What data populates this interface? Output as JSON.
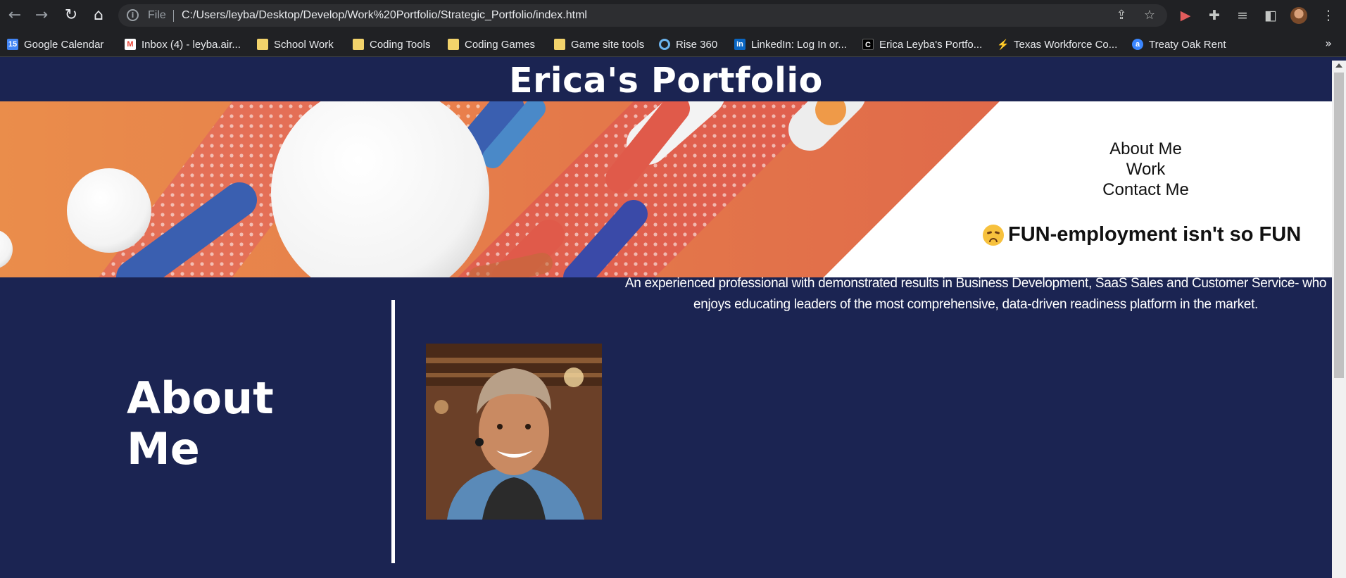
{
  "browser": {
    "url_scheme_label": "File",
    "url": "C:/Users/leyba/Desktop/Develop/Work%20Portfolio/Strategic_Portfolio/index.html",
    "bookmarks": [
      {
        "label": "Google Calendar",
        "icon": "calendar-icon",
        "color": "#4285f4"
      },
      {
        "label": "Inbox (4) - leyba.air...",
        "icon": "gmail-icon",
        "color": "#ea4335"
      },
      {
        "label": "School Work",
        "icon": "folder-icon",
        "color": "#f2d36b"
      },
      {
        "label": "Coding Tools",
        "icon": "folder-icon",
        "color": "#f2d36b"
      },
      {
        "label": "Coding Games",
        "icon": "folder-icon",
        "color": "#f2d36b"
      },
      {
        "label": "Game site tools",
        "icon": "folder-icon",
        "color": "#f2d36b"
      },
      {
        "label": "Rise 360",
        "icon": "rise-icon",
        "color": "#6cb4ee"
      },
      {
        "label": "LinkedIn: Log In or...",
        "icon": "linkedin-icon",
        "color": "#0a66c2"
      },
      {
        "label": "Erica Leyba's Portfo...",
        "icon": "codepen-icon",
        "color": "#000000"
      },
      {
        "label": "Texas Workforce Co...",
        "icon": "bolt-icon",
        "color": "#e7d44b"
      },
      {
        "label": "Treaty Oak Rent",
        "icon": "treaty-oak-icon",
        "color": "#3a86ff"
      }
    ],
    "more_label": "»"
  },
  "site": {
    "title": "Erica's Portfolio",
    "nav": [
      "About Me",
      "Work",
      "Contact Me"
    ],
    "tagline": "FUN-employment isn't so FUN",
    "about_heading_line1": "About",
    "about_heading_line2": "Me",
    "bio": "An experienced professional with demonstrated results in Business Development, SaaS Sales and Customer Service- who enjoys educating leaders of the most comprehensive, data-driven readiness platform in the market."
  },
  "colors": {
    "page_bg": "#1b2452",
    "banner_orange": "#e8884a",
    "banner_red": "#e0554a",
    "banner_blue": "#3a5fb0"
  }
}
